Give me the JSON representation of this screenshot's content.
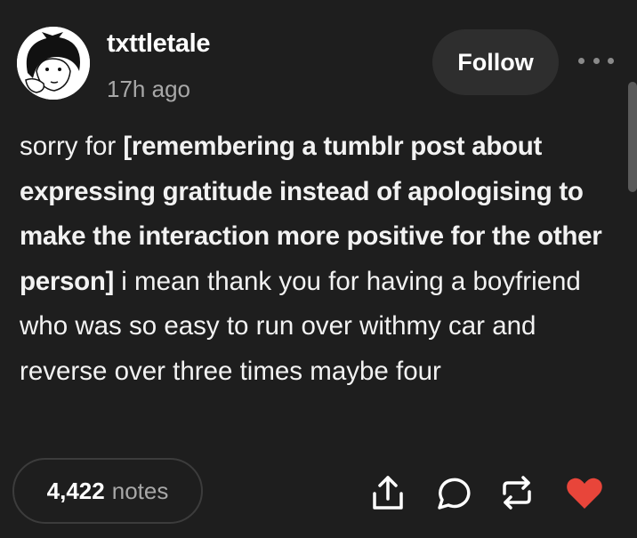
{
  "post": {
    "username": "txttletale",
    "timestamp": "17h ago",
    "follow_label": "Follow",
    "body": {
      "prefix": "sorry for ",
      "bold": "[remembering a tumblr post about expressing gratitude instead of apologising to make the interaction more positive for the other person]",
      "suffix": " i mean thank you for having a boyfriend who was so easy to run over withmy car and reverse over three times maybe four"
    }
  },
  "footer": {
    "notes_count": "4,422",
    "notes_label": "notes"
  },
  "icons": {
    "more": "more-horizontal-icon",
    "share": "share-icon",
    "reply": "reply-icon",
    "reblog": "reblog-icon",
    "like": "heart-icon"
  },
  "colors": {
    "background": "#1e1e1e",
    "follow_button": "#2e2e2e",
    "muted_text": "#a8a8a8",
    "like": "#e8453a"
  }
}
